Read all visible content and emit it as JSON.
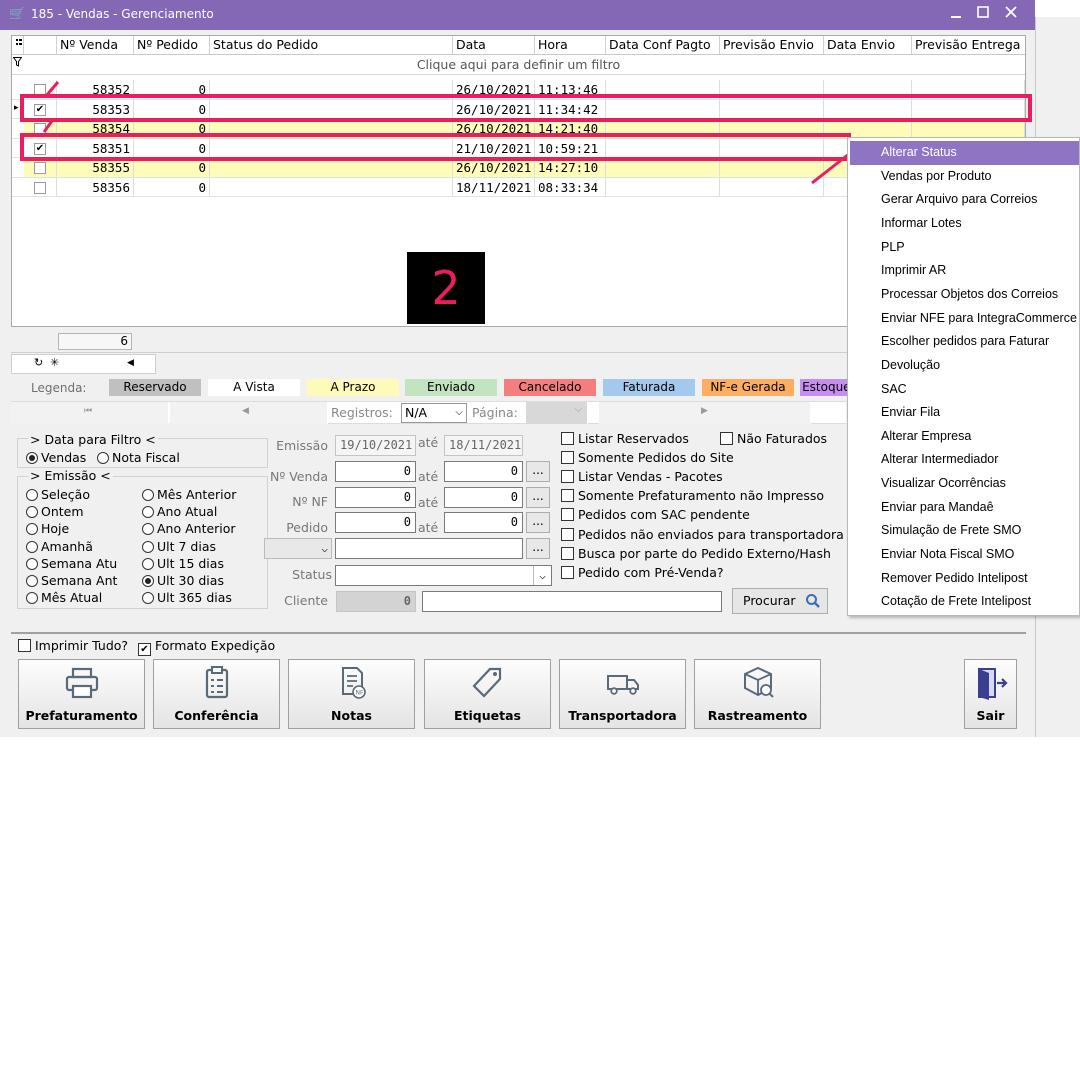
{
  "window": {
    "title": "185 - Vendas - Gerenciamento",
    "icon": "cart-icon",
    "controls": [
      "minimize",
      "maximize",
      "close"
    ]
  },
  "grid": {
    "columns": [
      "Nº Venda",
      "Nº Pedido",
      "Status do Pedido",
      "Data",
      "Hora",
      "Data Conf Pagto",
      "Previsão Envio",
      "Data Envio",
      "Previsão Entrega"
    ],
    "filter_hint": "Clique aqui para definir um filtro",
    "rows": [
      {
        "venda": "58352",
        "pedido": "0",
        "status": "",
        "data": "26/10/2021",
        "hora": "11:13:46",
        "checked": false,
        "color": "white"
      },
      {
        "venda": "58353",
        "pedido": "0",
        "status": "",
        "data": "26/10/2021",
        "hora": "11:34:42",
        "checked": true,
        "color": "white"
      },
      {
        "venda": "58354",
        "pedido": "0",
        "status": "",
        "data": "26/10/2021",
        "hora": "14:21:40",
        "checked": false,
        "color": "yellow"
      },
      {
        "venda": "58351",
        "pedido": "0",
        "status": "",
        "data": "21/10/2021",
        "hora": "10:59:21",
        "checked": true,
        "color": "white"
      },
      {
        "venda": "58355",
        "pedido": "0",
        "status": "",
        "data": "26/10/2021",
        "hora": "14:27:10",
        "checked": false,
        "color": "yellow"
      },
      {
        "venda": "58356",
        "pedido": "0",
        "status": "",
        "data": "18/11/2021",
        "hora": "08:33:34",
        "checked": false,
        "color": "white"
      }
    ],
    "record_count": "6"
  },
  "overlay": {
    "step_number": "2"
  },
  "legend": {
    "label": "Legenda:",
    "items": [
      {
        "text": "Reservado",
        "color": "#c0c0c0"
      },
      {
        "text": "A Vista",
        "color": "#ffffff"
      },
      {
        "text": "A Prazo",
        "color": "#fdfbb9"
      },
      {
        "text": "Enviado",
        "color": "#c3e4c1"
      },
      {
        "text": "Cancelado",
        "color": "#f47d7d"
      },
      {
        "text": "Faturada",
        "color": "#a4c9ee"
      },
      {
        "text": "NF-e Gerada",
        "color": "#fdae63"
      },
      {
        "text": "Estoque I",
        "color": "#c78ef0"
      }
    ]
  },
  "pager": {
    "registros_label": "Registros:",
    "registros_value": "N/A",
    "pagina_label": "Página:"
  },
  "filters": {
    "data_filtro_legend": "> Data para Filtro <",
    "data_filtro_options": [
      {
        "label": "Vendas",
        "selected": true
      },
      {
        "label": "Nota Fiscal",
        "selected": false
      }
    ],
    "emissao_legend": "> Emissão <",
    "emissao_options_left": [
      {
        "label": "Seleção",
        "selected": false
      },
      {
        "label": "Ontem",
        "selected": false
      },
      {
        "label": "Hoje",
        "selected": false
      },
      {
        "label": "Amanhã",
        "selected": false
      },
      {
        "label": "Semana Atu",
        "selected": false
      },
      {
        "label": "Semana Ant",
        "selected": false
      },
      {
        "label": "Mês Atual",
        "selected": false
      }
    ],
    "emissao_options_right": [
      {
        "label": "Mês Anterior",
        "selected": false
      },
      {
        "label": "Ano Atual",
        "selected": false
      },
      {
        "label": "Ano Anterior",
        "selected": false
      },
      {
        "label": "Ult 7 dias",
        "selected": false
      },
      {
        "label": "Ult 15 dias",
        "selected": false
      },
      {
        "label": "Ult 30 dias",
        "selected": true
      },
      {
        "label": "Ult 365 dias",
        "selected": false
      }
    ],
    "emissao_label": "Emissão",
    "emissao_from": "19/10/2021",
    "emissao_to": "18/11/2021",
    "ate": "até",
    "nvenda_label": "Nº Venda",
    "nvenda_from": "0",
    "nvenda_to": "0",
    "nnf_label": "Nº NF",
    "nnf_from": "0",
    "nnf_to": "0",
    "pedido_label": "Pedido",
    "pedido_from": "0",
    "pedido_to": "0",
    "status_label": "Status",
    "cliente_label": "Cliente",
    "cliente_code": "0",
    "dots": "...",
    "search_button": "Procurar",
    "checkboxes": [
      {
        "label": "Listar Reservados",
        "checked": false
      },
      {
        "label": "Somente Pedidos do Site",
        "checked": false
      },
      {
        "label": "Listar Vendas - Pacotes",
        "checked": false
      },
      {
        "label": "Somente Prefaturamento não Impresso",
        "checked": false
      },
      {
        "label": "Pedidos com SAC pendente",
        "checked": false
      },
      {
        "label": "Pedidos não enviados para transportadora",
        "checked": false
      },
      {
        "label": "Busca por parte do Pedido Externo/Hash",
        "checked": false
      },
      {
        "label": "Pedido com Pré-Venda?",
        "checked": false
      }
    ],
    "nao_faturados": {
      "label": "Não Faturados",
      "checked": false
    }
  },
  "options": {
    "imprimir_tudo": {
      "label": "Imprimir Tudo?",
      "checked": false
    },
    "formato_expedicao": {
      "label": "Formato Expedição",
      "checked": true
    }
  },
  "toolbar": {
    "buttons": [
      {
        "label": "Prefaturamento",
        "icon": "printer-icon"
      },
      {
        "label": "Conferência",
        "icon": "clipboard-icon"
      },
      {
        "label": "Notas",
        "icon": "invoice-icon"
      },
      {
        "label": "Etiquetas",
        "icon": "tag-icon"
      },
      {
        "label": "Transportadora",
        "icon": "truck-icon"
      },
      {
        "label": "Rastreamento",
        "icon": "package-search-icon"
      }
    ],
    "exit_label": "Sair"
  },
  "context_menu": {
    "items": [
      "Alterar Status",
      "Vendas por Produto",
      "Gerar Arquivo para Correios",
      "Informar Lotes",
      "PLP",
      "Imprimir AR",
      "Processar Objetos dos Correios",
      "Enviar NFE para IntegraCommerce",
      "Escolher pedidos para Faturar",
      "Devolução",
      "SAC",
      "Enviar Fila",
      "Alterar Empresa",
      "Alterar Intermediador",
      "Visualizar Ocorrências",
      "Enviar para Mandaê",
      "Simulação de Frete SMO",
      "Enviar Nota Fiscal SMO",
      "Remover Pedido Intelipost",
      "Cotação de Frete Intelipost"
    ],
    "active_index": 0
  },
  "colors": {
    "titlebar": "#8468b5",
    "highlight": "#ea1d5d",
    "menu_active": "#8e74c3",
    "row_yellow": "#fefcbb"
  }
}
